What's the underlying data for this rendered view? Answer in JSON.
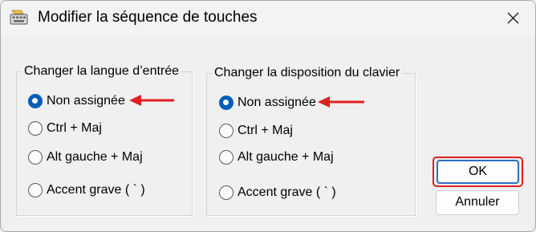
{
  "window": {
    "title": "Modifier la séquence de touches",
    "icon": "keyboard-icon",
    "close_icon": "close-icon"
  },
  "input_language_group": {
    "legend": "Changer la langue d’entrée",
    "options": [
      {
        "label": "Non assignée",
        "selected": true
      },
      {
        "label": "Ctrl + Maj",
        "selected": false
      },
      {
        "label": "Alt gauche + Maj",
        "selected": false
      },
      {
        "label": "Accent grave ( ` )",
        "selected": false
      }
    ]
  },
  "keyboard_layout_group": {
    "legend": "Changer la disposition du clavier",
    "options": [
      {
        "label": "Non assignée",
        "selected": true
      },
      {
        "label": "Ctrl + Maj",
        "selected": false
      },
      {
        "label": "Alt gauche + Maj",
        "selected": false
      },
      {
        "label": "Accent grave ( ` )",
        "selected": false
      }
    ]
  },
  "buttons": {
    "ok": "OK",
    "cancel": "Annuler"
  },
  "annotations": {
    "arrow_color": "#e02020",
    "highlight_color": "#e02020",
    "accent_color": "#005fb8"
  }
}
